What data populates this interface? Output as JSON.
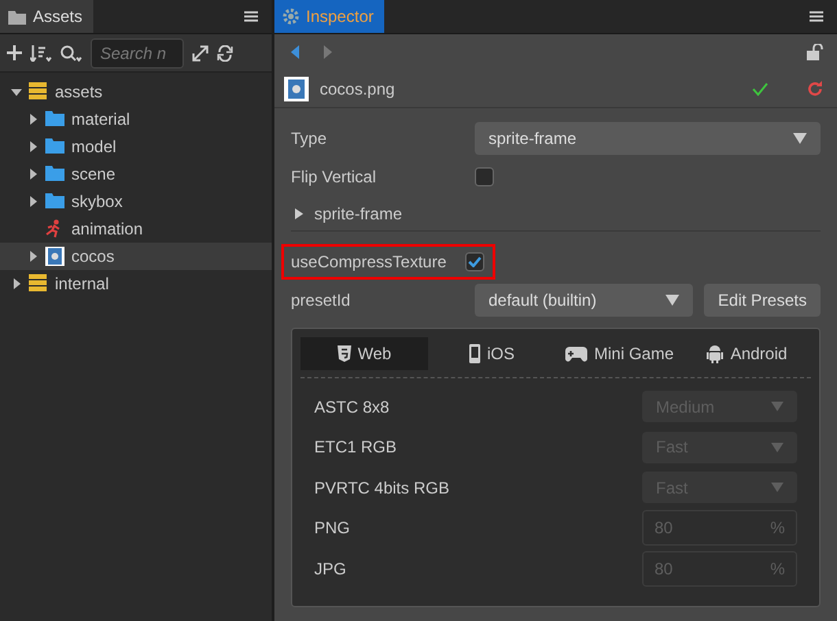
{
  "assets_panel": {
    "title": "Assets",
    "search": {
      "placeholder": "Search n"
    },
    "tree": [
      {
        "label": "assets",
        "kind": "database",
        "expanded": true,
        "selected": false,
        "children": [
          {
            "label": "material",
            "kind": "folder",
            "expanded": false,
            "selected": false
          },
          {
            "label": "model",
            "kind": "folder",
            "expanded": false,
            "selected": false
          },
          {
            "label": "scene",
            "kind": "folder",
            "expanded": false,
            "selected": false
          },
          {
            "label": "skybox",
            "kind": "folder",
            "expanded": false,
            "selected": false
          },
          {
            "label": "animation",
            "kind": "animation",
            "selected": false
          },
          {
            "label": "cocos",
            "kind": "image",
            "expanded": false,
            "selected": true
          }
        ]
      },
      {
        "label": "internal",
        "kind": "database",
        "expanded": false,
        "selected": false
      }
    ]
  },
  "inspector": {
    "title": "Inspector",
    "file": "cocos.png",
    "properties": [
      {
        "kind": "select",
        "label": "Type",
        "value": "sprite-frame"
      },
      {
        "kind": "checkbox",
        "label": "Flip Vertical",
        "checked": false,
        "highlighted": false
      },
      {
        "kind": "section",
        "label": "sprite-frame",
        "expanded": false
      },
      {
        "kind": "checkbox",
        "label": "useCompressTexture",
        "checked": true,
        "highlighted": true
      },
      {
        "kind": "select-button",
        "label": "presetId",
        "value": "default (builtin)",
        "button": "Edit Presets"
      }
    ],
    "platform_tabs": [
      {
        "label": "Web",
        "kind": "html5",
        "selected": true
      },
      {
        "label": "iOS",
        "kind": "phone",
        "selected": false
      },
      {
        "label": "Mini Game",
        "kind": "gamepad",
        "selected": false
      },
      {
        "label": "Android",
        "kind": "android",
        "selected": false
      }
    ],
    "settings": [
      {
        "kind": "select",
        "label": "ASTC 8x8",
        "value": "Medium",
        "disabled": true
      },
      {
        "kind": "select",
        "label": "ETC1 RGB",
        "value": "Fast",
        "disabled": true
      },
      {
        "kind": "select",
        "label": "PVRTC 4bits RGB",
        "value": "Fast",
        "disabled": true
      },
      {
        "kind": "number",
        "label": "PNG",
        "value": "80",
        "unit": "%",
        "disabled": true
      },
      {
        "kind": "number",
        "label": "JPG",
        "value": "80",
        "unit": "%",
        "disabled": true
      }
    ]
  }
}
